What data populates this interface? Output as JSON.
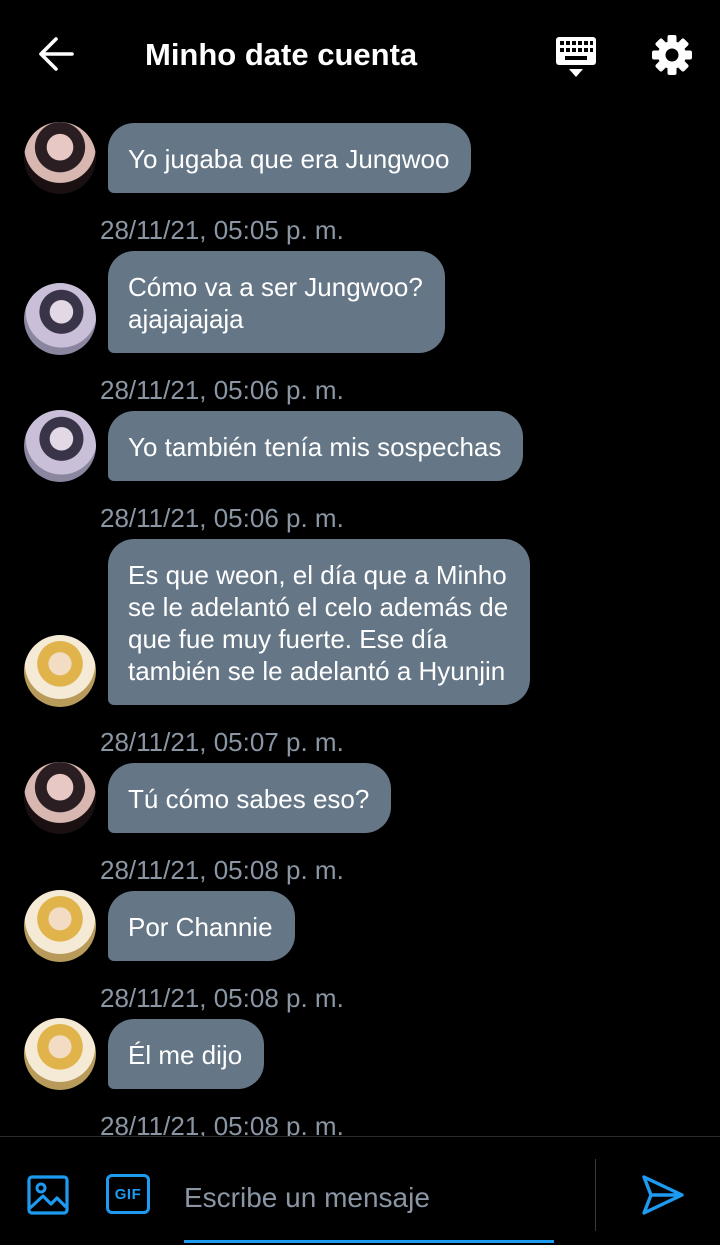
{
  "header": {
    "title": "Minho date cuenta",
    "back_icon": "arrow-left-icon",
    "keyboard_icon": "keyboard-icon",
    "settings_icon": "gear-icon"
  },
  "messages": [
    {
      "avatar": "a",
      "text": "Yo jugaba que era Jungwoo",
      "time": "28/11/21, 05:05 p. m."
    },
    {
      "avatar": "b",
      "text": "Cómo va a ser Jungwoo?\najajajajaja",
      "time": "28/11/21, 05:06 p. m."
    },
    {
      "avatar": "b",
      "text": "Yo también tenía mis sospechas",
      "time": "28/11/21, 05:06 p. m."
    },
    {
      "avatar": "c",
      "text": "Es que weon, el día que a Minho\nse le adelantó el celo además de\nque fue muy fuerte. Ese día\ntambién se le adelantó a Hyunjin",
      "time": "28/11/21, 05:07 p. m."
    },
    {
      "avatar": "a",
      "text": "Tú cómo sabes eso?",
      "time": "28/11/21, 05:08 p. m."
    },
    {
      "avatar": "c",
      "text": "Por Channie",
      "time": "28/11/21, 05:08 p. m."
    },
    {
      "avatar": "c",
      "text": "Él me dijo",
      "time": "28/11/21, 05:08 p. m."
    }
  ],
  "composer": {
    "placeholder": "Escribe un mensaje",
    "gif_label": "GIF",
    "image_icon": "image-icon",
    "send_icon": "send-icon"
  },
  "colors": {
    "bubble": "#657686",
    "accent": "#1d9bf0",
    "timestamp": "#8a96a3"
  }
}
